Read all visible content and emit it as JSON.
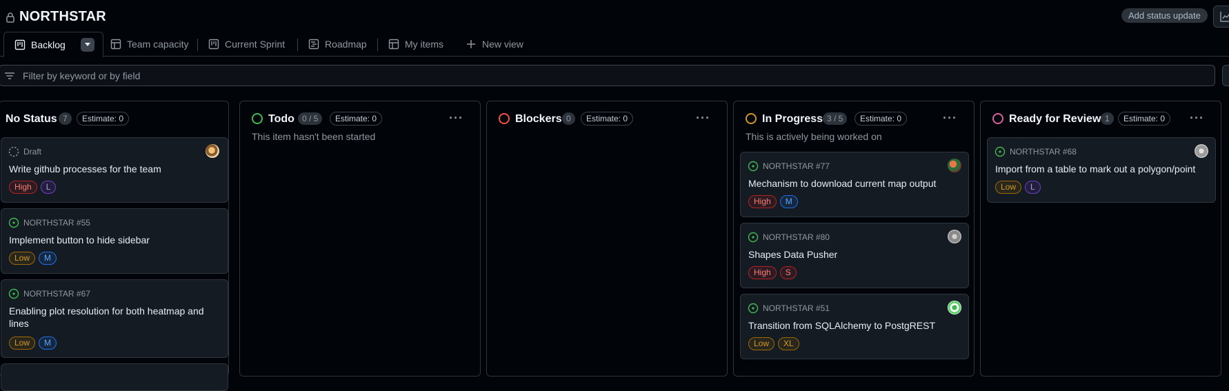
{
  "project": {
    "title": "NORTHSTAR",
    "status_button": "Add status update"
  },
  "tabs": [
    {
      "label": "Backlog",
      "icon": "board-icon"
    },
    {
      "label": "Team capacity",
      "icon": "table-icon"
    },
    {
      "label": "Current Sprint",
      "icon": "board-icon"
    },
    {
      "label": "Roadmap",
      "icon": "roadmap-icon"
    },
    {
      "label": "My items",
      "icon": "table-icon"
    },
    {
      "label": "New view",
      "icon": "plus-icon"
    }
  ],
  "filter": {
    "placeholder": "Filter by keyword or by field"
  },
  "columns": [
    {
      "name": "No Status",
      "count": "7",
      "estimate": "Estimate: 0",
      "color": null,
      "description": "",
      "cards": [
        {
          "meta": "Draft",
          "kind": "draft",
          "title": "Write github processes for the team",
          "tags": [
            "High",
            "L"
          ]
        },
        {
          "meta": "NORTHSTAR #55",
          "kind": "open",
          "title": "Implement button to hide sidebar",
          "tags": [
            "Low",
            "M"
          ]
        },
        {
          "meta": "NORTHSTAR #67",
          "kind": "open",
          "title": "Enabling plot resolution for both heatmap and lines",
          "tags": [
            "Low",
            "M"
          ]
        }
      ]
    },
    {
      "name": "Todo",
      "count": "0 / 5",
      "estimate": "Estimate: 0",
      "color": "#3fb950",
      "description": "This item hasn't been started",
      "cards": []
    },
    {
      "name": "Blockers",
      "count": "0",
      "estimate": "Estimate: 0",
      "color": "#f85149",
      "description": "",
      "cards": []
    },
    {
      "name": "In Progress",
      "count": "3 / 5",
      "estimate": "Estimate: 0",
      "color": "#d29922",
      "description": "This is actively being worked on",
      "cards": [
        {
          "meta": "NORTHSTAR #77",
          "kind": "open",
          "title": "Mechanism to download current map output",
          "tags": [
            "High",
            "M"
          ]
        },
        {
          "meta": "NORTHSTAR #80",
          "kind": "open",
          "title": "Shapes Data Pusher",
          "tags": [
            "High",
            "S"
          ]
        },
        {
          "meta": "NORTHSTAR #51",
          "kind": "open",
          "title": "Transition from SQLAlchemy to PostgREST",
          "tags": [
            "Low",
            "XL"
          ]
        }
      ]
    },
    {
      "name": "Ready for Review",
      "count": "1",
      "estimate": "Estimate: 0",
      "color": "#db61a2",
      "description": "",
      "cards": [
        {
          "meta": "NORTHSTAR #68",
          "kind": "open",
          "title": "Import from a table to mark out a polygon/point",
          "tags": [
            "Low",
            "L"
          ]
        }
      ]
    }
  ],
  "more_label": "···"
}
